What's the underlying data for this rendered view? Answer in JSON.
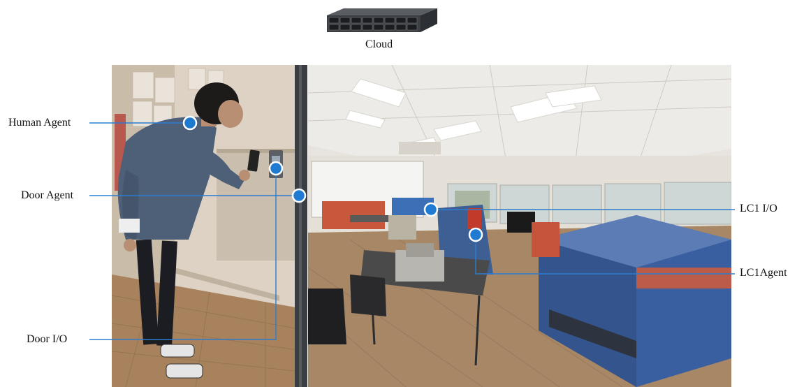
{
  "cloud": {
    "label": "Cloud",
    "icon": "server-rack-icon"
  },
  "labels": {
    "human_agent": "Human Agent",
    "door_agent": "Door Agent",
    "door_io": "Door I/O",
    "lc1_io": "LC1 I/O",
    "lc1_agent": "LC1Agent"
  },
  "colors": {
    "marker_fill": "#1f7ad1",
    "marker_stroke": "#ffffff",
    "leader_line": "#2a7dd0"
  },
  "photos": {
    "left": "person scanning phone at door panel",
    "right": "laser cutter workshop"
  }
}
